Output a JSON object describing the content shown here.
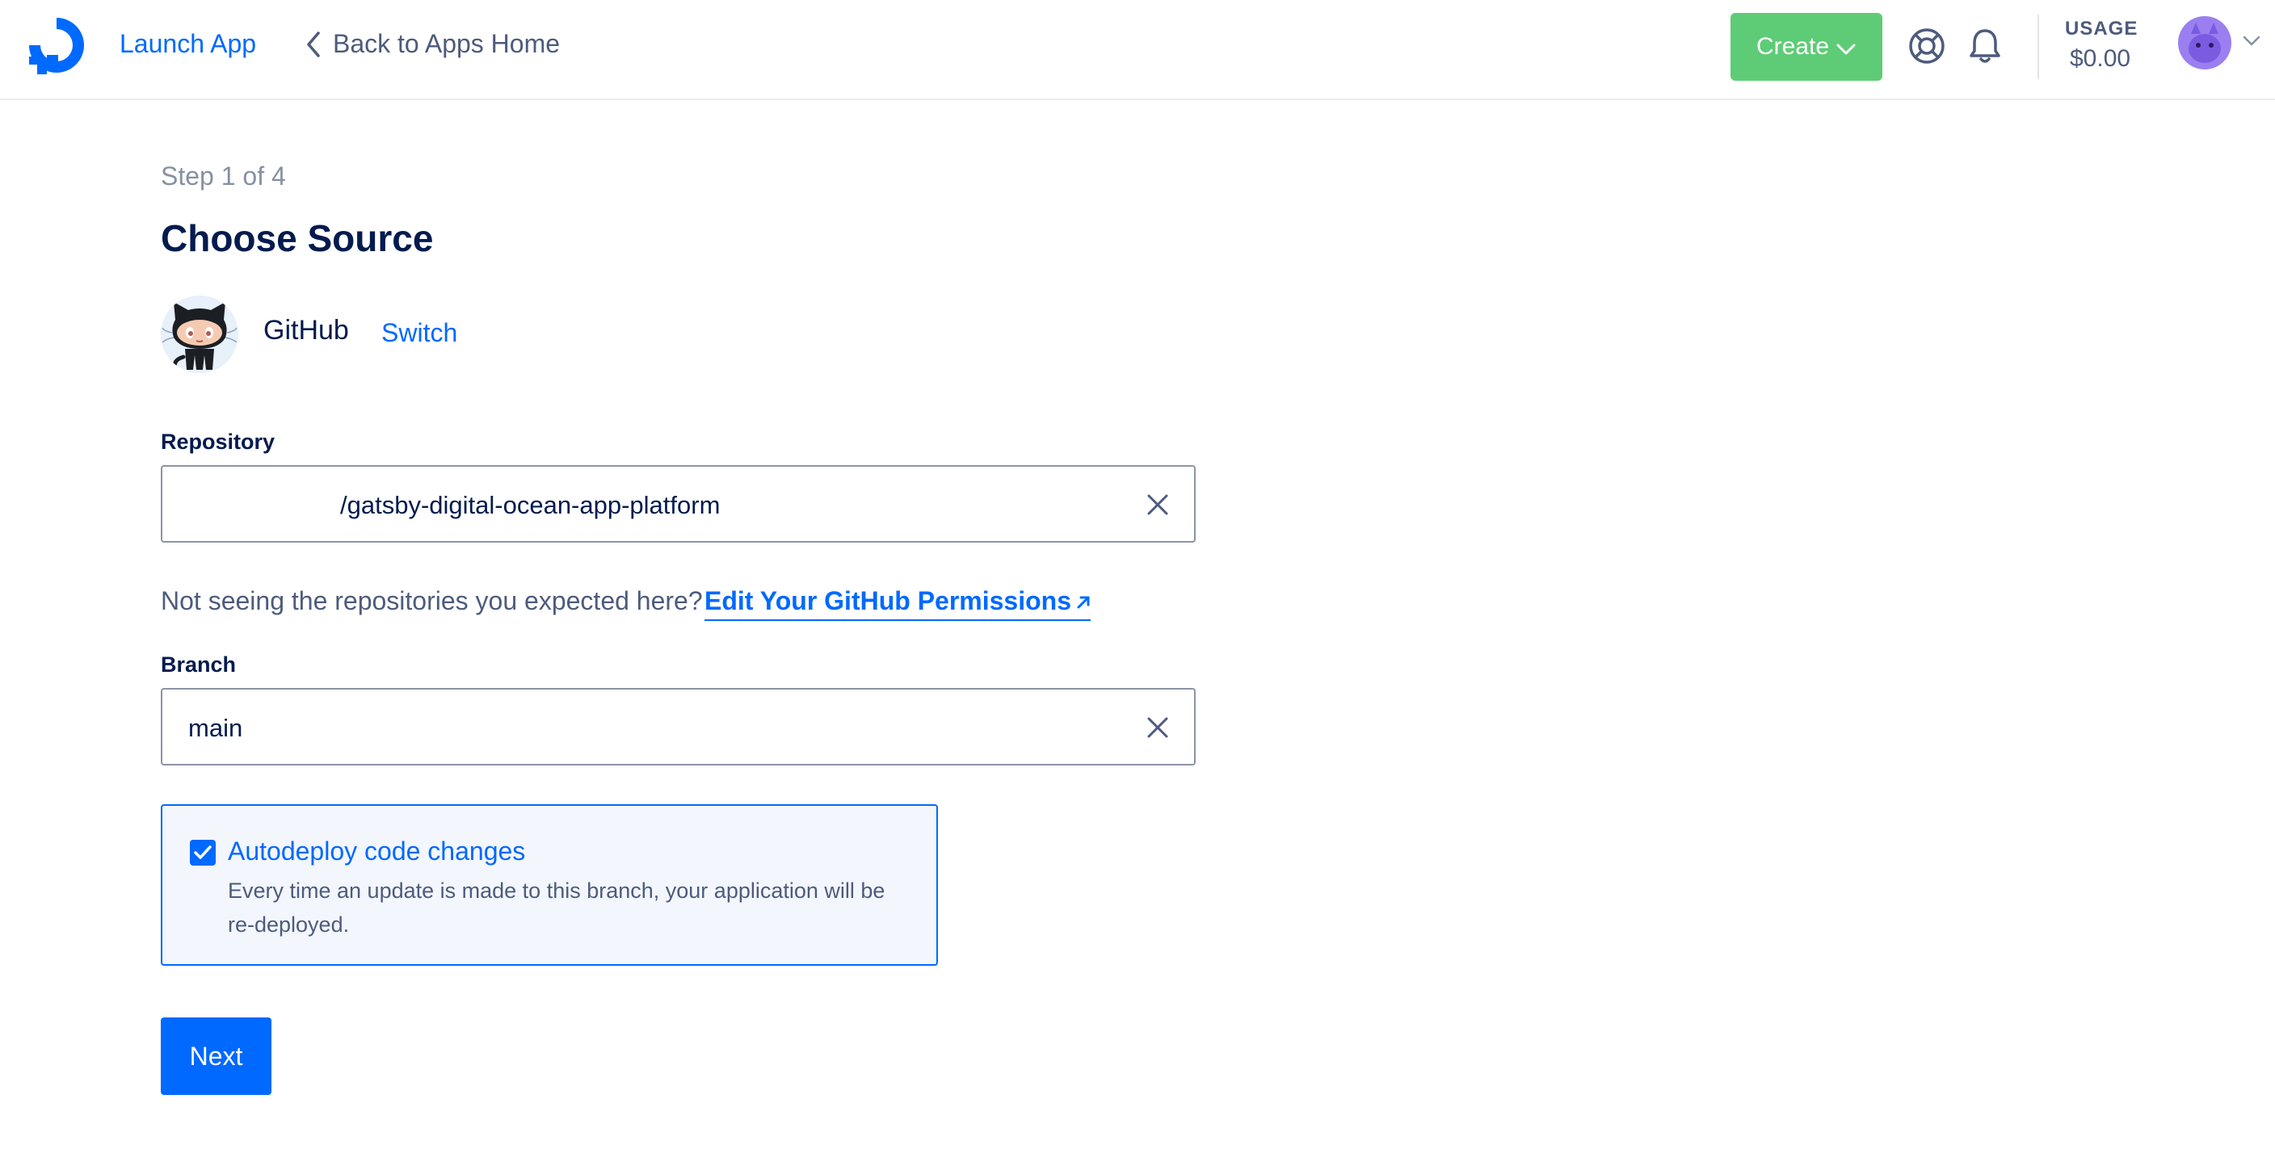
{
  "header": {
    "app_title": "Launch App",
    "back_label": "Back to Apps Home",
    "create_label": "Create",
    "usage_label": "USAGE",
    "usage_value": "$0.00"
  },
  "main": {
    "step": "Step 1 of 4",
    "title": "Choose Source",
    "source": {
      "name": "GitHub",
      "switch_label": "Switch"
    },
    "repository": {
      "label": "Repository",
      "value": "/gatsby-digital-ocean-app-platform"
    },
    "hint": "Not seeing the repositories you expected here?",
    "permissions_link": "Edit Your GitHub Permissions",
    "branch": {
      "label": "Branch",
      "value": "main"
    },
    "autodeploy": {
      "title": "Autodeploy code changes",
      "description": "Every time an update is made to this branch, your application will be re-deployed.",
      "checked": true
    },
    "next_label": "Next"
  },
  "colors": {
    "brand_blue": "#0069ff",
    "create_green": "#5ecc76",
    "text_dark": "#031b4e",
    "text_muted": "#4d5b7c"
  },
  "icons": [
    "digitalocean-logo-icon",
    "chevron-left-icon",
    "chevron-down-icon",
    "lifebuoy-icon",
    "bell-icon",
    "avatar-icon",
    "octocat-icon",
    "close-icon",
    "external-arrow-icon",
    "checkmark-icon"
  ]
}
